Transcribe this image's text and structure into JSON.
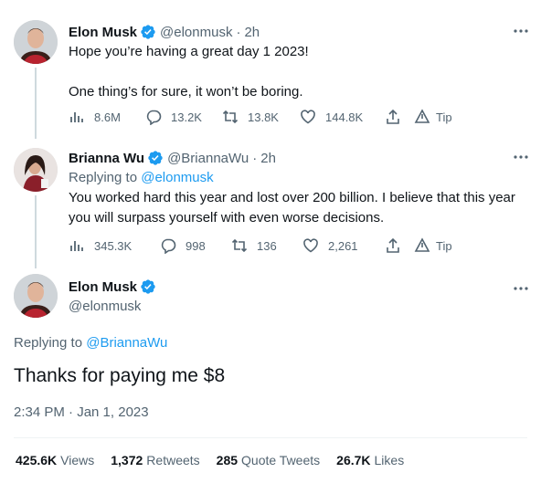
{
  "icons": {
    "verified_color": "#1d9bf0",
    "link_color": "#1d9bf0"
  },
  "tweet1": {
    "name": "Elon Musk",
    "handle": "@elonmusk",
    "dot": "·",
    "time": "2h",
    "line1": "Hope you’re having a great day 1 2023!",
    "line2": "One thing’s for sure, it won’t be boring.",
    "views": "8.6M",
    "replies": "13.2K",
    "retweets": "13.8K",
    "likes": "144.8K",
    "tip": "Tip"
  },
  "tweet2": {
    "name": "Brianna Wu",
    "handle": "@BriannaWu",
    "dot": "·",
    "time": "2h",
    "replying_prefix": "Replying to",
    "replying_to": "@elonmusk",
    "line1": "You worked hard this year and lost over 200 billion. I believe that this year",
    "line2": "you will surpass yourself with even worse decisions.",
    "views": "345.3K",
    "replies": "998",
    "retweets": "136",
    "likes": "2,261",
    "tip": "Tip"
  },
  "main": {
    "name": "Elon Musk",
    "handle": "@elonmusk",
    "replying_prefix": "Replying to",
    "replying_to": "@BriannaWu",
    "text": "Thanks for paying me $8",
    "timestamp": "2:34 PM · Jan 1, 2023",
    "stats": {
      "views_count": "425.6K",
      "views_label": "Views",
      "retweets_count": "1,372",
      "retweets_label": "Retweets",
      "quotes_count": "285",
      "quotes_label": "Quote Tweets",
      "likes_count": "26.7K",
      "likes_label": "Likes"
    }
  }
}
